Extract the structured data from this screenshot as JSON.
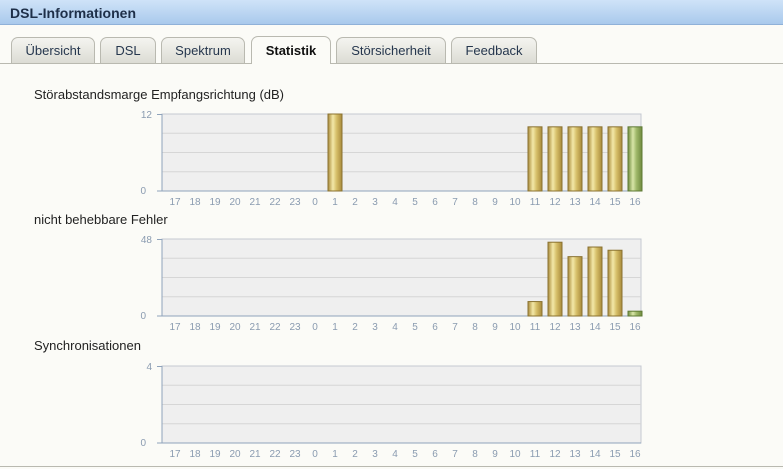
{
  "window": {
    "title": "DSL-Informationen"
  },
  "tabs": [
    {
      "label": "Übersicht",
      "active": false
    },
    {
      "label": "DSL",
      "active": false
    },
    {
      "label": "Spektrum",
      "active": false
    },
    {
      "label": "Statistik",
      "active": true
    },
    {
      "label": "Störsicherheit",
      "active": false
    },
    {
      "label": "Feedback",
      "active": false
    }
  ],
  "colors": {
    "bar_gold": "#d7c06a",
    "bar_green": "#9fb86a",
    "plot_bg": "#efefef",
    "axis_label": "#8a9bb0"
  },
  "chart_data": [
    {
      "type": "bar",
      "title": "Störabstandsmarge Empfangsrichtung (dB)",
      "categories": [
        "17",
        "18",
        "19",
        "20",
        "21",
        "22",
        "23",
        "0",
        "1",
        "2",
        "3",
        "4",
        "5",
        "6",
        "7",
        "8",
        "9",
        "10",
        "11",
        "12",
        "13",
        "14",
        "15",
        "16"
      ],
      "values": [
        0,
        0,
        0,
        0,
        0,
        0,
        0,
        0,
        12,
        0,
        0,
        0,
        0,
        0,
        0,
        0,
        0,
        0,
        10,
        10,
        10,
        10,
        10,
        10
      ],
      "ylim": [
        0,
        12
      ],
      "ytick_labels": [
        "12",
        "0"
      ],
      "grid": true
    },
    {
      "type": "bar",
      "title": "nicht behebbare Fehler",
      "categories": [
        "17",
        "18",
        "19",
        "20",
        "21",
        "22",
        "23",
        "0",
        "1",
        "2",
        "3",
        "4",
        "5",
        "6",
        "7",
        "8",
        "9",
        "10",
        "11",
        "12",
        "13",
        "14",
        "15",
        "16"
      ],
      "values": [
        0,
        0,
        0,
        0,
        0,
        0,
        0,
        0,
        0,
        0,
        0,
        0,
        0,
        0,
        0,
        0,
        0,
        0,
        9,
        46,
        37,
        43,
        41,
        3
      ],
      "ylim": [
        0,
        48
      ],
      "ytick_labels": [
        "48",
        "0"
      ],
      "grid": true
    },
    {
      "type": "bar",
      "title": "Synchronisationen",
      "categories": [
        "17",
        "18",
        "19",
        "20",
        "21",
        "22",
        "23",
        "0",
        "1",
        "2",
        "3",
        "4",
        "5",
        "6",
        "7",
        "8",
        "9",
        "10",
        "11",
        "12",
        "13",
        "14",
        "15",
        "16"
      ],
      "values": [
        0,
        0,
        0,
        0,
        0,
        0,
        0,
        0,
        0,
        0,
        0,
        0,
        0,
        0,
        0,
        0,
        0,
        0,
        0,
        0,
        0,
        0,
        0,
        0
      ],
      "ylim": [
        0,
        4
      ],
      "ytick_labels": [
        "4",
        "0"
      ],
      "grid": true
    }
  ]
}
